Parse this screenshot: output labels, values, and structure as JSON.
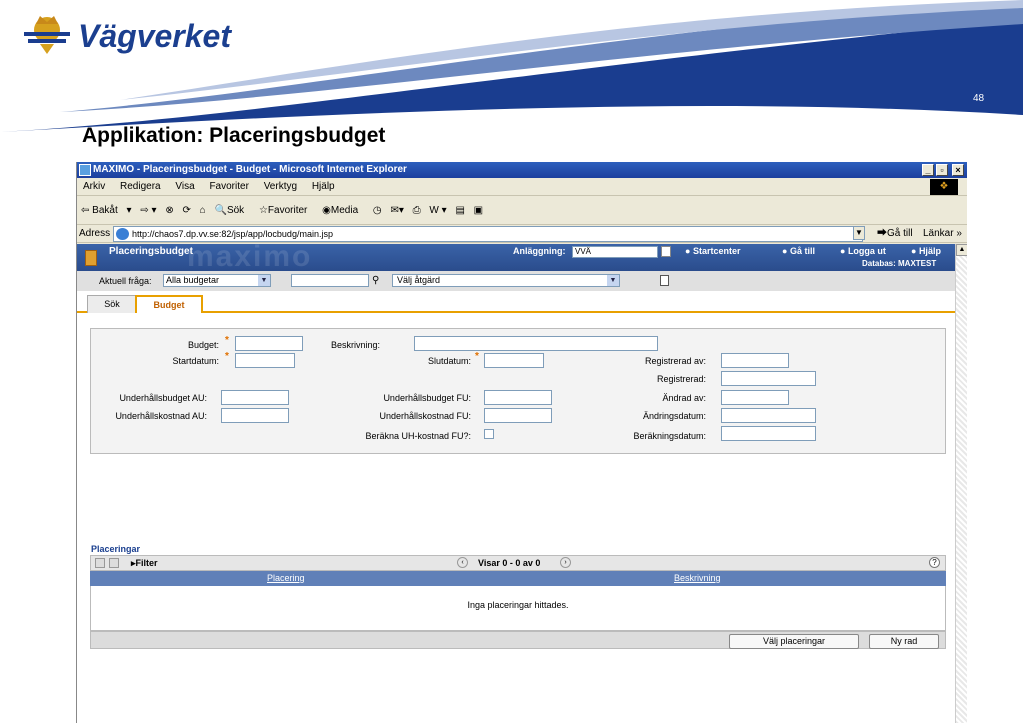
{
  "slide": {
    "logo_text": "Vägverket",
    "number": "48",
    "title": "Applikation:  Placeringsbudget"
  },
  "browser": {
    "title": "MAXIMO - Placeringsbudget - Budget - Microsoft Internet Explorer",
    "menu": [
      "Arkiv",
      "Redigera",
      "Visa",
      "Favoriter",
      "Verktyg",
      "Hjälp"
    ],
    "toolbar": {
      "back": "Bakåt",
      "search": "Sök",
      "favorites": "Favoriter",
      "media": "Media"
    },
    "address_label": "Adress",
    "url": "http://chaos7.dp.vv.se:82/jsp/app/locbudg/main.jsp",
    "go": "Gå till",
    "links": "Länkar"
  },
  "maximo": {
    "watermark": "maximo",
    "app_name": "Placeringsbudget",
    "anlaggning_label": "Anläggning:",
    "anlaggning_value": "VVÄ",
    "links": {
      "start": "Startcenter",
      "goto": "Gå till",
      "logout": "Logga ut",
      "help": "Hjälp"
    },
    "database": "Databas: MAXTEST",
    "query_label": "Aktuell fråga:",
    "query_value": "Alla budgetar",
    "action_value": "Välj åtgärd",
    "tabs": {
      "search": "Sök",
      "budget": "Budget"
    }
  },
  "form": {
    "budget": "Budget:",
    "beskrivning": "Beskrivning:",
    "startdatum": "Startdatum:",
    "slutdatum": "Slutdatum:",
    "registrerad_av": "Registrerad av:",
    "registrerad": "Registrerad:",
    "underhallsbudget_au": "Underhållsbudget AU:",
    "underhallsbudget_fu": "Underhållsbudget FU:",
    "andrad_av": "Ändrad av:",
    "underhallskostnad_au": "Underhållskostnad AU:",
    "underhallskostnad_fu": "Underhållskostnad FU:",
    "andringsdatum": "Ändringsdatum:",
    "berakna_uh": "Beräkna UH-kostnad FU?:",
    "berakningsdatum": "Beräkningsdatum:"
  },
  "placeringar": {
    "title": "Placeringar",
    "filter": "Filter",
    "paging": "Visar 0 - 0 av 0",
    "columns": [
      "Placering",
      "Beskrivning"
    ],
    "empty": "Inga placeringar hittades.",
    "btn_select": "Välj placeringar",
    "btn_new": "Ny rad"
  }
}
